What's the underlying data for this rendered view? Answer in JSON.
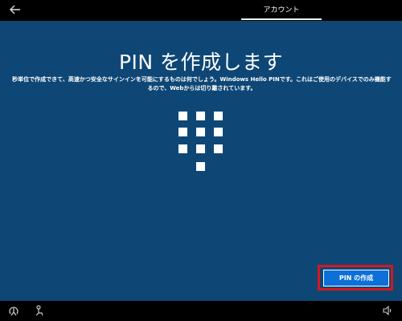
{
  "header": {
    "back_icon": "back-arrow-icon",
    "active_tab_label": "アカウント"
  },
  "main": {
    "title": "PIN を作成します",
    "description": "秒単位で作成できて、高速かつ安全なサインインを可能にするものは何でしょう。Windows Hello PINです。これはご使用のデバイスでのみ機能するので、Webからは切り離されています。",
    "keypad_icon": "pin-keypad-icon"
  },
  "actions": {
    "create_pin_label": "PIN の作成"
  },
  "footer": {
    "accessibility_icon": "ease-of-access-icon",
    "account_icon": "accessibility-person-icon",
    "volume_icon": "volume-icon"
  },
  "colors": {
    "background": "#0e4776",
    "bars": "#000000",
    "button": "#0d6fd8",
    "highlight": "#d4171f"
  }
}
